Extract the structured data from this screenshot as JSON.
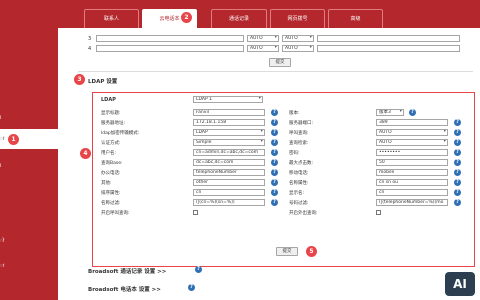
{
  "sidebar": {
    "items": [
      {
        "label": "i"
      },
      {
        "label": "ा"
      },
      {
        "label": "i"
      },
      {
        "label": "ो"
      },
      {
        "label": "ा"
      }
    ],
    "badge_1": "1"
  },
  "tabs": [
    {
      "label": "联系人"
    },
    {
      "label": "云电话本"
    },
    {
      "label": "通话记录"
    },
    {
      "label": "网页拨号"
    },
    {
      "label": "高级"
    }
  ],
  "badges": {
    "b2": "2",
    "b3": "3",
    "b4": "4",
    "b5": "5"
  },
  "top_rows": [
    {
      "index": "3",
      "sel1": "AUTO",
      "sel2": "AUTO"
    },
    {
      "index": "4",
      "sel1": "AUTO",
      "sel2": "AUTO"
    }
  ],
  "submit_label": "提交",
  "ldap_section_title": "LDAP 设置",
  "ldap": {
    "header": "LDAP",
    "header_select": "LDAP 1",
    "display_title_label": "显示标题:",
    "display_title_value": "Fanvil",
    "version_label": "版本:",
    "version_value": "版本3",
    "server_addr_label": "服务器地址:",
    "server_addr_value": "172.18.1.158",
    "server_port_label": "服务器端口:",
    "server_port_value": "389",
    "ldap_type_label": "ldap加密传输模式:",
    "ldap_type_value": "LDAP",
    "call_lookup_label": "呼叫查询:",
    "call_lookup_value": "AUTO",
    "auth_label": "认证方式:",
    "auth_value": "Simple",
    "search_lookup_label": "查询检索:",
    "search_lookup_value": "AUTO",
    "username_label": "用户名:",
    "username_value": "cn=admin,dc=abc,dc=com",
    "password_label": "密码:",
    "password_value": "••••••••",
    "search_base_label": "查询Base:",
    "search_base_value": "dc=abc,dc=com",
    "max_hits_label": "最大点击数:",
    "max_hits_value": "50",
    "office_phone_label": "办公电话:",
    "office_phone_value": "telephoneNumber",
    "mobile_label": "移动电话:",
    "mobile_value": "mobile",
    "other_label": "其他:",
    "other_value": "other",
    "name_attr_label": "名称属性:",
    "name_attr_value": "cn sn ou",
    "sort_attr_label": "排序属性:",
    "sort_attr_value": "cn",
    "display_name_label": "显示名:",
    "display_name_value": "cn",
    "name_filter_label": "名称过滤:",
    "name_filter_value": "(|(cn=%)(sn=%))",
    "number_filter_label": "号码过滤:",
    "number_filter_value": "(|(telephoneNumber=%)(mo",
    "enable_call_lookup_label": "开启呼叫查询:",
    "enable_out_lookup_label": "开启外出查询:"
  },
  "submit2_label": "提交",
  "broadsoft_call_log": "Broadsoft 通话记录 设置 >>",
  "broadsoft_phonebook": "Broadsoft 电话本 设置 >>",
  "watermark": "AI"
}
